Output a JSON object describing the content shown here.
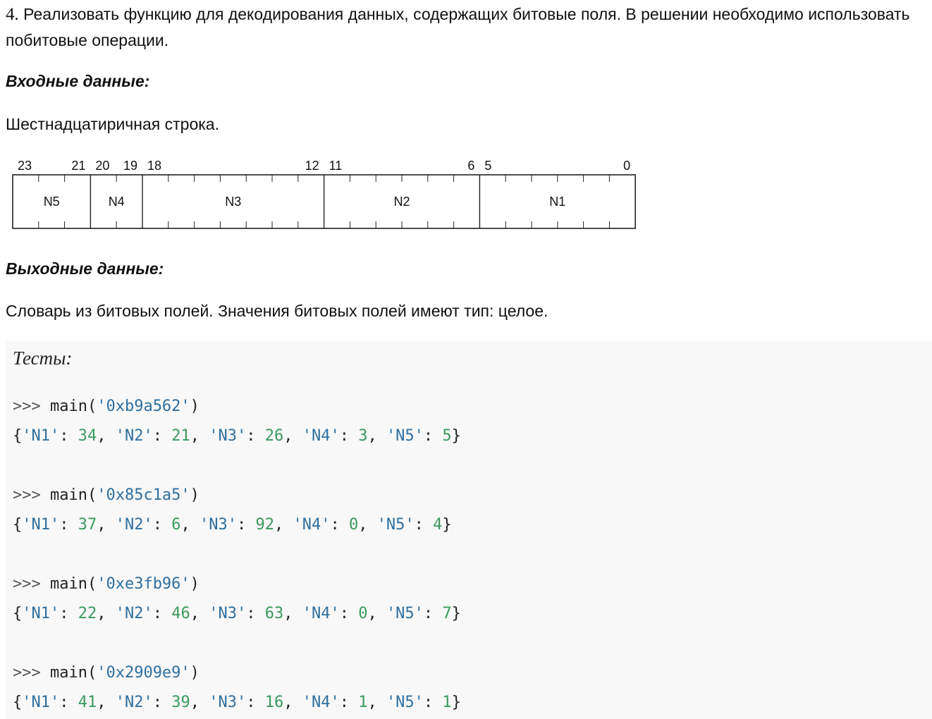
{
  "task": {
    "number": "4.",
    "text": "Реализовать функцию для декодирования данных, содержащих битовые поля. В решении необходимо использовать побитовые операции."
  },
  "input": {
    "heading": "Входные данные:",
    "description": "Шестнадцатиричная строка."
  },
  "diagram": {
    "total_bits": 24,
    "bit_labels": [
      "23",
      "21",
      "20",
      "19",
      "18",
      "12",
      "11",
      "6",
      "5",
      "0"
    ],
    "fields": [
      {
        "name": "N5",
        "high": 23,
        "low": 21
      },
      {
        "name": "N4",
        "high": 20,
        "low": 19
      },
      {
        "name": "N3",
        "high": 18,
        "low": 12
      },
      {
        "name": "N2",
        "high": 11,
        "low": 6
      },
      {
        "name": "N1",
        "high": 5,
        "low": 0
      }
    ]
  },
  "output": {
    "heading": "Выходные данные:",
    "description": "Словарь из битовых полей. Значения битовых полей имеют тип: целое."
  },
  "tests": {
    "title": "Тесты:",
    "prompt": ">>>",
    "cases": [
      {
        "arg": "0xb9a562",
        "result": [
          [
            "N1",
            "34"
          ],
          [
            "N2",
            "21"
          ],
          [
            "N3",
            "26"
          ],
          [
            "N4",
            "3"
          ],
          [
            "N5",
            "5"
          ]
        ]
      },
      {
        "arg": "0x85c1a5",
        "result": [
          [
            "N1",
            "37"
          ],
          [
            "N2",
            "6"
          ],
          [
            "N3",
            "92"
          ],
          [
            "N4",
            "0"
          ],
          [
            "N5",
            "4"
          ]
        ]
      },
      {
        "arg": "0xe3fb96",
        "result": [
          [
            "N1",
            "22"
          ],
          [
            "N2",
            "46"
          ],
          [
            "N3",
            "63"
          ],
          [
            "N4",
            "0"
          ],
          [
            "N5",
            "7"
          ]
        ]
      },
      {
        "arg": "0x2909e9",
        "result": [
          [
            "N1",
            "41"
          ],
          [
            "N2",
            "39"
          ],
          [
            "N3",
            "16"
          ],
          [
            "N4",
            "1"
          ],
          [
            "N5",
            "1"
          ]
        ]
      }
    ]
  }
}
